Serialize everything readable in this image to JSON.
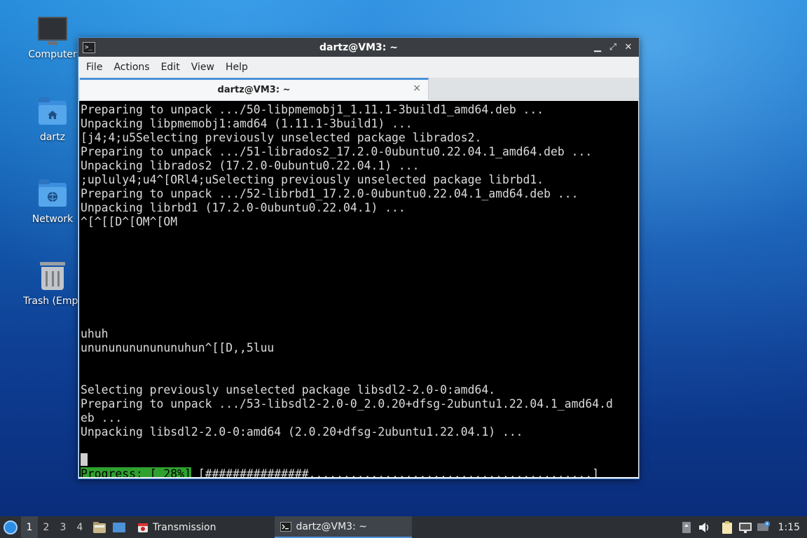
{
  "desktop": {
    "icons": [
      {
        "label": "Computer"
      },
      {
        "label": "dartz"
      },
      {
        "label": "Network"
      },
      {
        "label": "Trash (Empt"
      }
    ]
  },
  "window": {
    "title": "dartz@VM3: ~",
    "controls": {
      "minimize": "▁",
      "maximize": "⤢",
      "close": "✕"
    },
    "menu": [
      "File",
      "Actions",
      "Edit",
      "View",
      "Help"
    ],
    "tab": {
      "title": "dartz@VM3: ~",
      "close": "×"
    }
  },
  "terminal": {
    "lines": [
      "Preparing to unpack .../50-libpmemobj1_1.11.1-3build1_amd64.deb ...",
      "Unpacking libpmemobj1:amd64 (1.11.1-3build1) ...",
      "[j4;4;u5Selecting previously unselected package librados2.",
      "Preparing to unpack .../51-librados2_17.2.0-0ubuntu0.22.04.1_amd64.deb ...",
      "Unpacking librados2 (17.2.0-0ubuntu0.22.04.1) ...",
      ";upluly4;u4^[ORl4;uSelecting previously unselected package librbd1.",
      "Preparing to unpack .../52-librbd1_17.2.0-0ubuntu0.22.04.1_amd64.deb ...",
      "Unpacking librbd1 (17.2.0-0ubuntu0.22.04.1) ...",
      "^[^[[D^[OM^[OM",
      "",
      "",
      "",
      "",
      "",
      "",
      "",
      "uhuh",
      "unununununununuhun^[[D,,5luu",
      "",
      "",
      "Selecting previously unselected package libsdl2-2.0-0:amd64.",
      "Preparing to unpack .../53-libsdl2-2.0-0_2.0.20+dfsg-2ubuntu1.22.04.1_amd64.d",
      "eb ...",
      "Unpacking libsdl2-2.0-0:amd64 (2.0.20+dfsg-2ubuntu1.22.04.1) ...",
      ""
    ],
    "progress_label": "Progress: [ 28%]",
    "progress_bar": " [###############.........................................]",
    "progress_percent": 28
  },
  "taskbar": {
    "workspaces": [
      "1",
      "2",
      "3",
      "4"
    ],
    "active_workspace": "1",
    "tasks": [
      {
        "label": "Transmission",
        "icon": "transmission-icon"
      },
      {
        "label": "dartz@VM3: ~",
        "icon": "terminal-icon"
      }
    ],
    "clock": "1:15"
  },
  "colors": {
    "accent": "#4c92d8",
    "terminal_bg": "#000000",
    "progress_green": "#2fa12f",
    "taskbar_bg": "#2c2f33"
  }
}
